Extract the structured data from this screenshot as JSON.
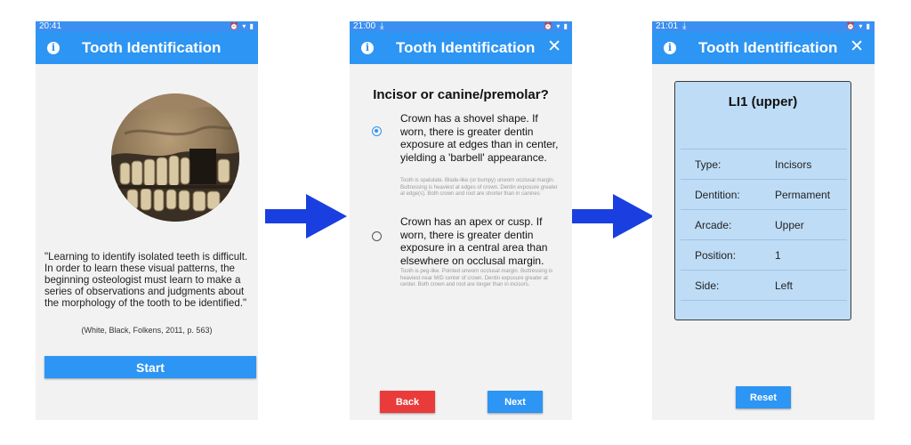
{
  "colors": {
    "accent": "#2d95f3",
    "arrow": "#1a3fe0",
    "back": "#ea3b3b",
    "card": "#bedcf6"
  },
  "screens": [
    {
      "status": {
        "time": "20:41",
        "icons": "⏰ ▾ ▮"
      },
      "appbar": {
        "title": "Tooth Identification",
        "info_icon": "i"
      },
      "quote": "\"Learning to identify isolated teeth is difficult. In order to learn these visual patterns, the beginning osteologist must learn to make a series of observations and judgments about the morphology of the tooth to be identified.\"",
      "citation": "(White, Black, Folkens, 2011, p. 563)",
      "start_label": "Start"
    },
    {
      "status": {
        "time": "21:00",
        "icons": "⏰ ▾ ▮"
      },
      "appbar": {
        "title": "Tooth Identification",
        "info_icon": "i",
        "close_icon": "✕"
      },
      "question": "Incisor or canine/premolar?",
      "options": [
        {
          "text": "Crown has a shovel shape. If worn, there is greater dentin exposure at edges than in center, yielding a 'barbell' appearance.",
          "note": "Tooth is spatulate. Blade-like (or bumpy) unworn occlusal margin. Buttressing is heaviest at edges of crown. Dentin exposure greater at edge(s). Both crown and root are shorter than in canines",
          "selected": true
        },
        {
          "text": "Crown has an apex or cusp. If worn, there is greater dentin exposure in a central area than elsewhere on occlusal margin.",
          "note": "Tooth is peg-like. Pointed unworn occlusal margin. Buttressing is heaviest near M/D center of crown. Dentin exposure greater at center. Both crown and root are longer than in incisors.",
          "selected": false
        }
      ],
      "back_label": "Back",
      "next_label": "Next"
    },
    {
      "status": {
        "time": "21:01",
        "icons": "⏰ ▾ ▮"
      },
      "appbar": {
        "title": "Tooth Identification",
        "info_icon": "i",
        "close_icon": "✕"
      },
      "result_title": "LI1 (upper)",
      "rows": [
        {
          "key": "Type:",
          "value": "Incisors"
        },
        {
          "key": "Dentition:",
          "value": "Permament"
        },
        {
          "key": "Arcade:",
          "value": "Upper"
        },
        {
          "key": "Position:",
          "value": "1"
        },
        {
          "key": "Side:",
          "value": "Left"
        }
      ],
      "reset_label": "Reset"
    }
  ]
}
